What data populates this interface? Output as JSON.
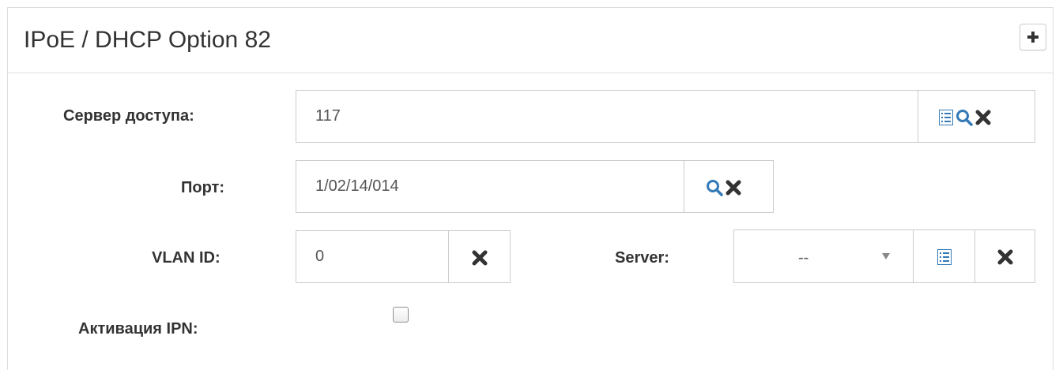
{
  "panel": {
    "title": "IPoE / DHCP Option 82",
    "collapse_icon": "plus-icon"
  },
  "form": {
    "access_server": {
      "label": "Сервер доступа:",
      "value": "117",
      "icons": [
        "list-icon",
        "search-icon",
        "clear-icon"
      ]
    },
    "port": {
      "label": "Порт:",
      "value": "1/02/14/014",
      "icons": [
        "search-icon",
        "clear-icon"
      ]
    },
    "vlan_id": {
      "label": "VLAN ID:",
      "value": "0",
      "icons": [
        "clear-icon"
      ]
    },
    "server": {
      "label": "Server:",
      "selected": "--",
      "icons": [
        "list-icon",
        "clear-icon"
      ]
    },
    "ipn_activation": {
      "label": "Активация IPN:",
      "checked": false
    }
  },
  "colors": {
    "icon_blue": "#337ab7",
    "icon_dark": "#333333",
    "border": "#cccccc",
    "panel_border": "#dddddd"
  }
}
